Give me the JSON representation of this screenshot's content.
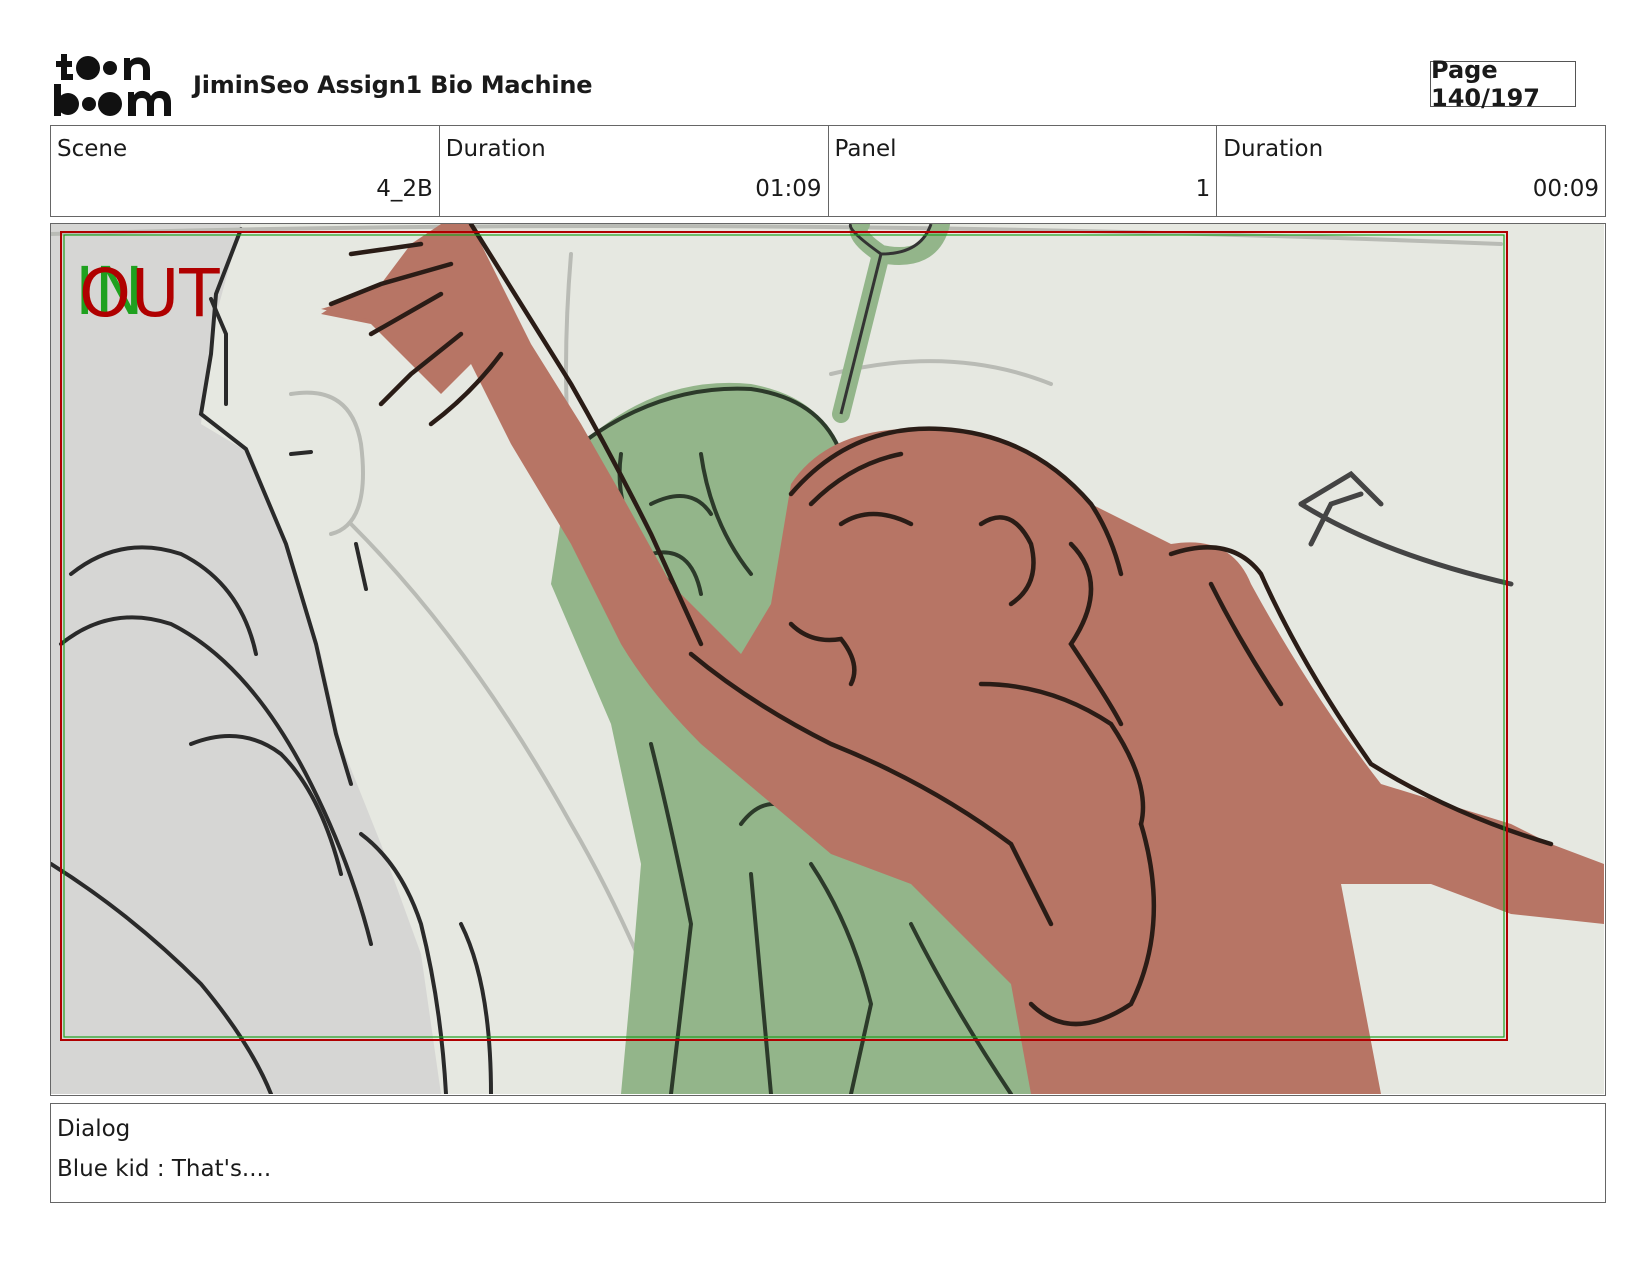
{
  "header": {
    "logo_text_top": "toon",
    "logo_text_bottom": "boom",
    "title": "JiminSeo Assign1 Bio Machine",
    "page_label": "Page 140/197"
  },
  "info": [
    {
      "label": "Scene",
      "value": "4_2B"
    },
    {
      "label": "Duration",
      "value": "01:09"
    },
    {
      "label": "Panel",
      "value": "1"
    },
    {
      "label": "Duration",
      "value": "00:09"
    }
  ],
  "panel": {
    "in_marker": "IN",
    "out_marker": "OUT",
    "in_color": "#1fa11f",
    "out_color": "#b00000",
    "illustration": "storyboard-sketch"
  },
  "dialog": {
    "label": "Dialog",
    "text": "Blue kid : That's...."
  }
}
